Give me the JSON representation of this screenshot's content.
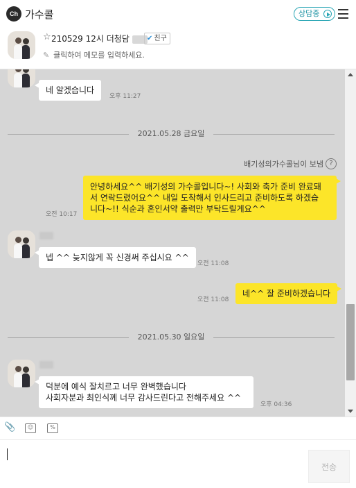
{
  "app": {
    "logo_text": "Ch",
    "title": "가수콜",
    "status_label": "상담중"
  },
  "room": {
    "name": "210529 12시 더청담",
    "badge_label": "친구",
    "memo_placeholder": "클릭하여 메모를 입력하세요."
  },
  "messages": {
    "m1": {
      "text": "네 알겠습니다",
      "time": "오후 11:27"
    },
    "date1": "2021.05.28 금요일",
    "sent_by": "배기성의가수콜님이 보냄",
    "m2": {
      "text": "안녕하세요^^ 배기성의 가수콜입니다~! 사회와 축가 준비 완료돼\n서 연락드렸어요^^ 내일 도착해서 인사드리고 준비하도록 하겠습\n니다~!! 식순과 혼인서약 출력만 부탁드릴게요^^",
      "time": "오전 10:17"
    },
    "m3": {
      "text": "넵 ^^ 늦지않게 꼭 신경써 주십시요 ^^",
      "time": "오전 11:08"
    },
    "m4": {
      "text": "네^^ 잘 준비하겠습니다",
      "time": "오전 11:08"
    },
    "date2": "2021.05.30 일요일",
    "m5": {
      "text": "덕분에 예식 잘치르고 너무 완벽했습니다\n사회자분과 최인식께 너무 감사드린다고 전해주세요 ^^",
      "time": "오후 04:36"
    }
  },
  "composer": {
    "send_label": "전송"
  },
  "colors": {
    "accent": "#2aa6b5",
    "my_bubble": "#fce529",
    "chat_bg": "#d6d6d6"
  },
  "icons": [
    "menu-icon",
    "star-icon",
    "check-icon",
    "pencil-icon",
    "help-icon",
    "attach-icon",
    "emoticon-icon",
    "capture-icon"
  ]
}
